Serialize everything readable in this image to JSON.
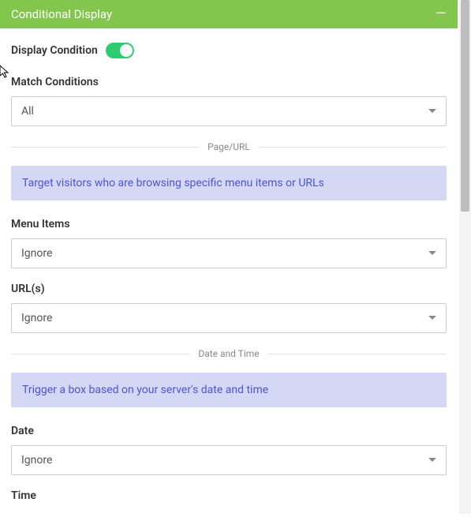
{
  "header": {
    "title": "Conditional Display"
  },
  "toggle": {
    "label": "Display Condition"
  },
  "match": {
    "label": "Match Conditions",
    "value": "All"
  },
  "sections": {
    "page_url": {
      "divider": "Page/URL",
      "info": "Target visitors who are browsing specific menu items or URLs",
      "menu_items": {
        "label": "Menu Items",
        "value": "Ignore"
      },
      "urls": {
        "label": "URL(s)",
        "value": "Ignore"
      }
    },
    "date_time": {
      "divider": "Date and Time",
      "info": "Trigger a box based on your server's date and time",
      "date": {
        "label": "Date",
        "value": "Ignore"
      },
      "time": {
        "label": "Time"
      }
    }
  }
}
